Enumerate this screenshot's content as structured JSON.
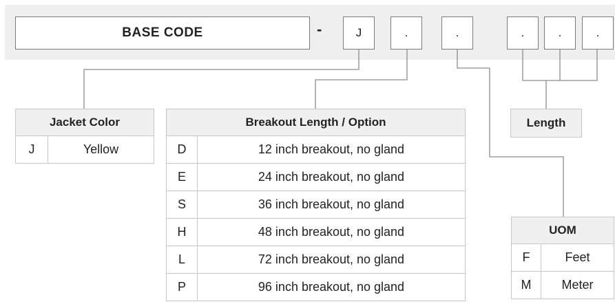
{
  "code_row": {
    "base_label": "BASE  CODE",
    "separator": "-",
    "segments": [
      "J",
      ".",
      ".",
      ".",
      ".",
      "."
    ]
  },
  "jacket_table": {
    "header": "Jacket Color",
    "rows": [
      {
        "code": "J",
        "desc": "Yellow"
      }
    ]
  },
  "breakout_table": {
    "header": "Breakout Length / Option",
    "rows": [
      {
        "code": "D",
        "desc": "12 inch breakout, no gland"
      },
      {
        "code": "E",
        "desc": "24 inch breakout, no gland"
      },
      {
        "code": "S",
        "desc": "36 inch breakout, no gland"
      },
      {
        "code": "H",
        "desc": "48 inch breakout, no gland"
      },
      {
        "code": "L",
        "desc": "72 inch breakout, no gland"
      },
      {
        "code": "P",
        "desc": "96 inch breakout, no gland"
      }
    ]
  },
  "length_table": {
    "header": "Length"
  },
  "uom_table": {
    "header": "UOM",
    "rows": [
      {
        "code": "F",
        "desc": "Feet"
      },
      {
        "code": "M",
        "desc": "Meter"
      }
    ]
  },
  "colors": {
    "band": "#efefef",
    "border": "#7a7a7a",
    "header_bg": "#f0f0f0",
    "connector": "#8c8c8c"
  }
}
